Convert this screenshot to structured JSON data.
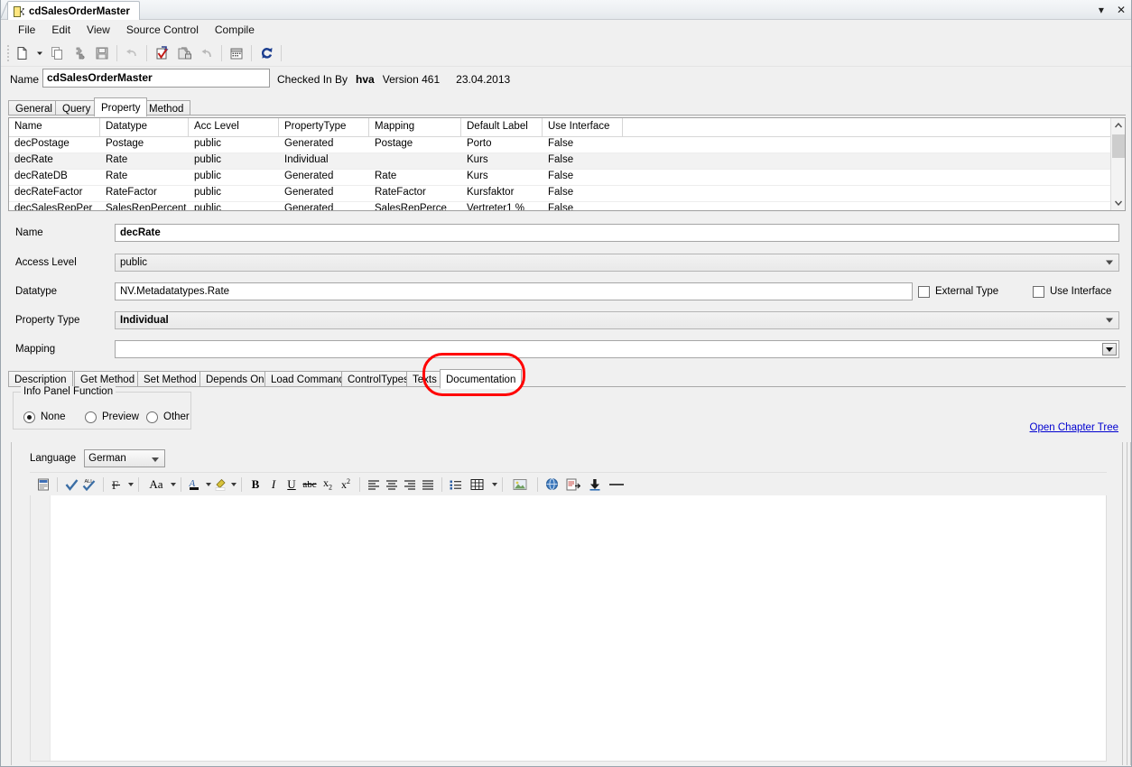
{
  "window": {
    "tab_title": "cdSalesOrderMaster",
    "tab_icon": "document-class-icon",
    "minimize_label": "▾",
    "close_label": "✕"
  },
  "menu": {
    "items": [
      {
        "label": "File",
        "name": "menu-file"
      },
      {
        "label": "Edit",
        "name": "menu-edit"
      },
      {
        "label": "View",
        "name": "menu-view"
      },
      {
        "label": "Source Control",
        "name": "menu-source-control"
      },
      {
        "label": "Compile",
        "name": "menu-compile"
      }
    ]
  },
  "toolbar": {
    "buttons": [
      {
        "name": "new-icon",
        "title": "New"
      },
      {
        "name": "dropdown-arrow-icon",
        "title": "New options"
      },
      {
        "name": "copy-icon",
        "title": "Copy"
      },
      {
        "name": "plugin-icon",
        "title": "Add-in"
      },
      {
        "name": "save-icon",
        "title": "Save"
      },
      {
        "name": "undo-disabled-icon",
        "title": "Undo"
      },
      {
        "name": "check-in-icon",
        "title": "Check In"
      },
      {
        "name": "check-out-lock-icon",
        "title": "Check Out"
      },
      {
        "name": "revert-icon",
        "title": "Undo Check Out"
      },
      {
        "name": "calendar-history-icon",
        "title": "History"
      },
      {
        "name": "refresh-icon",
        "title": "Refresh"
      }
    ]
  },
  "header": {
    "name_label": "Name",
    "name_value": "cdSalesOrderMaster",
    "checked_in_by_label": "Checked In By",
    "checked_in_by_value": "hva",
    "version_label": "Version",
    "version_value": "461",
    "date_value": "23.04.2013"
  },
  "top_tabs": {
    "items": [
      {
        "label": "General",
        "name": "tab-general",
        "active": false
      },
      {
        "label": "Query",
        "name": "tab-query",
        "active": false
      },
      {
        "label": "Property",
        "name": "tab-property",
        "active": true
      },
      {
        "label": "Method",
        "name": "tab-method",
        "active": false
      }
    ]
  },
  "grid": {
    "columns": [
      "Name",
      "Datatype",
      "Acc Level",
      "PropertyType",
      "Mapping",
      "Default Label",
      "Use Interface"
    ],
    "rows": [
      {
        "cells": [
          "decPostage",
          "Postage",
          "public",
          "Generated",
          "Postage",
          "Porto",
          "False"
        ],
        "selected": false
      },
      {
        "cells": [
          "decRate",
          "Rate",
          "public",
          "Individual",
          "",
          "Kurs",
          "False"
        ],
        "selected": true
      },
      {
        "cells": [
          "decRateDB",
          "Rate",
          "public",
          "Generated",
          "Rate",
          "Kurs",
          "False"
        ],
        "selected": false
      },
      {
        "cells": [
          "decRateFactor",
          "RateFactor",
          "public",
          "Generated",
          "RateFactor",
          "Kursfaktor",
          "False"
        ],
        "selected": false
      },
      {
        "cells": [
          "decSalesRepPer",
          "SalesRepPercent",
          "public",
          "Generated",
          "SalesRepPerce",
          "Vertreter1 %",
          "False"
        ],
        "selected": false
      }
    ],
    "scrollbar": {
      "up_arrow": "▲",
      "down_arrow": "▼"
    }
  },
  "detail": {
    "name_label": "Name",
    "name_value": "decRate",
    "access_level_label": "Access Level",
    "access_level_value": "public",
    "datatype_label": "Datatype",
    "datatype_value": "NV.Metadatatypes.Rate",
    "property_type_label": "Property Type",
    "property_type_value": "Individual",
    "mapping_label": "Mapping",
    "mapping_value": "",
    "external_type_label": "External Type",
    "external_type_checked": false,
    "use_interface_label": "Use Interface",
    "use_interface_checked": false
  },
  "bottom_tabs": {
    "items": [
      {
        "label": "Description",
        "name": "tab-description",
        "active": false
      },
      {
        "label": "Get Method",
        "name": "tab-get-method",
        "active": false
      },
      {
        "label": "Set Method",
        "name": "tab-set-method",
        "active": false
      },
      {
        "label": "Depends On",
        "name": "tab-depends-on",
        "active": false
      },
      {
        "label": "Load Command",
        "name": "tab-load-command",
        "active": false
      },
      {
        "label": "ControlTypes",
        "name": "tab-control-types",
        "active": false
      },
      {
        "label": "Texts",
        "name": "tab-texts",
        "active": false
      },
      {
        "label": "Documentation",
        "name": "tab-documentation",
        "active": true
      }
    ]
  },
  "annotation": {
    "shape": "ellipse",
    "color": "#ff0000",
    "target": "tab-documentation"
  },
  "info_panel": {
    "group_title": "Info Panel Function",
    "options": [
      {
        "label": "None",
        "selected": true
      },
      {
        "label": "Preview",
        "selected": false
      },
      {
        "label": "Other",
        "selected": false
      }
    ]
  },
  "links": {
    "open_chapter_tree": "Open Chapter Tree",
    "link_color": "#0000d0"
  },
  "editor": {
    "language_label": "Language",
    "language_value": "German",
    "content": "",
    "toolbar_buttons": [
      {
        "name": "document-properties-icon",
        "title": "Properties"
      },
      {
        "name": "spellcheck-icon",
        "title": "Check Spelling"
      },
      {
        "name": "spellcheck-all-icon",
        "title": "Check All"
      },
      {
        "name": "clear-formatting-icon",
        "title": "Clear Formatting"
      },
      {
        "name": "font-size-icon",
        "title": "Font Size"
      },
      {
        "name": "font-color-icon",
        "title": "Font Color"
      },
      {
        "name": "highlight-color-icon",
        "title": "Highlight"
      },
      {
        "name": "bold-icon",
        "title": "Bold"
      },
      {
        "name": "italic-icon",
        "title": "Italic"
      },
      {
        "name": "underline-icon",
        "title": "Underline"
      },
      {
        "name": "strikethrough-icon",
        "title": "Strikethrough"
      },
      {
        "name": "subscript-icon",
        "title": "Subscript"
      },
      {
        "name": "superscript-icon",
        "title": "Superscript"
      },
      {
        "name": "align-left-icon",
        "title": "Align Left"
      },
      {
        "name": "align-center-icon",
        "title": "Align Center"
      },
      {
        "name": "align-right-icon",
        "title": "Align Right"
      },
      {
        "name": "align-justify-icon",
        "title": "Justify"
      },
      {
        "name": "bullet-list-icon",
        "title": "Bullets"
      },
      {
        "name": "table-icon",
        "title": "Insert Table"
      },
      {
        "name": "insert-image-icon",
        "title": "Insert Image"
      },
      {
        "name": "insert-link-icon",
        "title": "Insert Hyperlink"
      },
      {
        "name": "insert-document-icon",
        "title": "Insert Document"
      },
      {
        "name": "download-icon",
        "title": "Download"
      },
      {
        "name": "horizontal-rule-icon",
        "title": "Horizontal Line"
      }
    ],
    "toolbar_labels": {
      "bold": "B",
      "italic": "I",
      "underline": "U",
      "strike": "abc",
      "sub": "x",
      "sub_n": "2",
      "sup": "x",
      "sup_n": "2",
      "fontsize": "Aa"
    }
  },
  "colors": {
    "window_bg": "#f0f0f0",
    "accent_red": "#ff0000",
    "link": "#0000d0",
    "selected_row": "#f2f2f2"
  }
}
